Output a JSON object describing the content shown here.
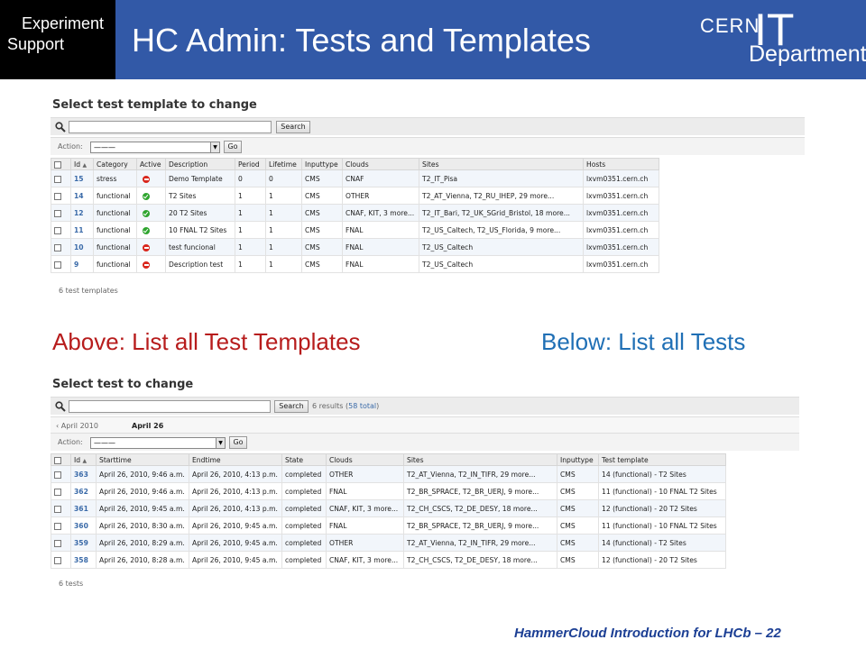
{
  "header": {
    "badge_line1": "Experiment",
    "badge_line2": "Support",
    "title": "HC Admin: Tests and Templates",
    "logo_cern": "CERN",
    "logo_it": "IT",
    "logo_department": "Department"
  },
  "templates_panel": {
    "title": "Select test template to change",
    "search_button": "Search",
    "action_label": "Action:",
    "action_value": "———",
    "go_button": "Go",
    "columns": [
      "Id",
      "Category",
      "Active",
      "Description",
      "Period",
      "Lifetime",
      "Inputtype",
      "Clouds",
      "Sites",
      "Hosts"
    ],
    "rows": [
      {
        "id": "15",
        "category": "stress",
        "active": "no",
        "description": "Demo Template",
        "period": "0",
        "lifetime": "0",
        "inputtype": "CMS",
        "clouds": "CNAF",
        "sites": "T2_IT_Pisa",
        "hosts": "lxvm0351.cern.ch"
      },
      {
        "id": "14",
        "category": "functional",
        "active": "yes",
        "description": "T2 Sites",
        "period": "1",
        "lifetime": "1",
        "inputtype": "CMS",
        "clouds": "OTHER",
        "sites": "T2_AT_Vienna, T2_RU_IHEP, 29 more...",
        "hosts": "lxvm0351.cern.ch"
      },
      {
        "id": "12",
        "category": "functional",
        "active": "yes",
        "description": "20 T2 Sites",
        "period": "1",
        "lifetime": "1",
        "inputtype": "CMS",
        "clouds": "CNAF, KIT, 3 more...",
        "sites": "T2_IT_Bari, T2_UK_SGrid_Bristol, 18 more...",
        "hosts": "lxvm0351.cern.ch"
      },
      {
        "id": "11",
        "category": "functional",
        "active": "yes",
        "description": "10 FNAL T2 Sites",
        "period": "1",
        "lifetime": "1",
        "inputtype": "CMS",
        "clouds": "FNAL",
        "sites": "T2_US_Caltech, T2_US_Florida, 9 more...",
        "hosts": "lxvm0351.cern.ch"
      },
      {
        "id": "10",
        "category": "functional",
        "active": "no",
        "description": "test funcional",
        "period": "1",
        "lifetime": "1",
        "inputtype": "CMS",
        "clouds": "FNAL",
        "sites": "T2_US_Caltech",
        "hosts": "lxvm0351.cern.ch"
      },
      {
        "id": "9",
        "category": "functional",
        "active": "no",
        "description": "Description test",
        "period": "1",
        "lifetime": "1",
        "inputtype": "CMS",
        "clouds": "FNAL",
        "sites": "T2_US_Caltech",
        "hosts": "lxvm0351.cern.ch"
      }
    ],
    "count_text": "6 test templates"
  },
  "captions": {
    "left": "Above: List all Test Templates",
    "right": "Below: List all Tests"
  },
  "tests_panel": {
    "title": "Select test to change",
    "search_button": "Search",
    "results_text": "6 results (",
    "results_total": "58 total",
    "results_close": ")",
    "crumb_prev": "‹ April 2010",
    "crumb_current": "April 26",
    "action_label": "Action:",
    "action_value": "———",
    "go_button": "Go",
    "columns": [
      "Id",
      "Starttime",
      "Endtime",
      "State",
      "Clouds",
      "Sites",
      "Inputtype",
      "Test template"
    ],
    "rows": [
      {
        "id": "363",
        "start": "April 26, 2010, 9:46 a.m.",
        "end": "April 26, 2010, 4:13 p.m.",
        "state": "completed",
        "clouds": "OTHER",
        "sites": "T2_AT_Vienna, T2_IN_TIFR, 29 more...",
        "inputtype": "CMS",
        "template": "14 (functional) - T2 Sites"
      },
      {
        "id": "362",
        "start": "April 26, 2010, 9:46 a.m.",
        "end": "April 26, 2010, 4:13 p.m.",
        "state": "completed",
        "clouds": "FNAL",
        "sites": "T2_BR_SPRACE, T2_BR_UERJ, 9 more...",
        "inputtype": "CMS",
        "template": "11 (functional) - 10 FNAL T2 Sites"
      },
      {
        "id": "361",
        "start": "April 26, 2010, 9:45 a.m.",
        "end": "April 26, 2010, 4:13 p.m.",
        "state": "completed",
        "clouds": "CNAF, KIT, 3 more...",
        "sites": "T2_CH_CSCS, T2_DE_DESY, 18 more...",
        "inputtype": "CMS",
        "template": "12 (functional) - 20 T2 Sites"
      },
      {
        "id": "360",
        "start": "April 26, 2010, 8:30 a.m.",
        "end": "April 26, 2010, 9:45 a.m.",
        "state": "completed",
        "clouds": "FNAL",
        "sites": "T2_BR_SPRACE, T2_BR_UERJ, 9 more...",
        "inputtype": "CMS",
        "template": "11 (functional) - 10 FNAL T2 Sites"
      },
      {
        "id": "359",
        "start": "April 26, 2010, 8:29 a.m.",
        "end": "April 26, 2010, 9:45 a.m.",
        "state": "completed",
        "clouds": "OTHER",
        "sites": "T2_AT_Vienna, T2_IN_TIFR, 29 more...",
        "inputtype": "CMS",
        "template": "14 (functional) - T2 Sites"
      },
      {
        "id": "358",
        "start": "April 26, 2010, 8:28 a.m.",
        "end": "April 26, 2010, 9:45 a.m.",
        "state": "completed",
        "clouds": "CNAF, KIT, 3 more...",
        "sites": "T2_CH_CSCS, T2_DE_DESY, 18 more...",
        "inputtype": "CMS",
        "template": "12 (functional) - 20 T2 Sites"
      }
    ],
    "count_text": "6 tests"
  },
  "footer": "HammerCloud Introduction for LHCb – 22"
}
